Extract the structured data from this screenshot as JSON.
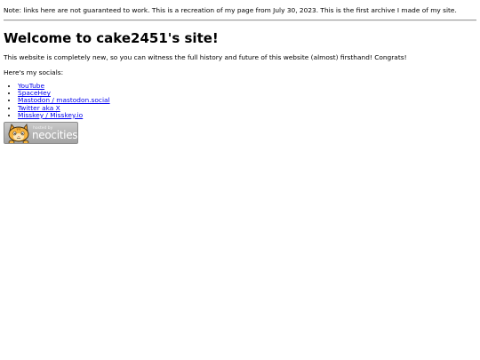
{
  "note": "Note: links here are not guaranteed to work. This is a recreation of my page from July 30, 2023. This is the first archive I made of my site.",
  "heading": "Welcome to cake2451's site!",
  "intro": "This website is completely new, so you can witness the full history and future of this website (almost) firsthand! Congrats!",
  "socials_heading": "Here's my socials:",
  "socials": [
    {
      "label": "YouTube"
    },
    {
      "label": "SpaceHey"
    },
    {
      "label": "Mastodon / mastodon.social"
    },
    {
      "label": "Twitter aka X"
    },
    {
      "label": "Misskey / Misskey.io"
    }
  ],
  "badge": {
    "small_text": "hosted by",
    "brand_text": "neocities",
    "icon": "neocities-cat-logo"
  },
  "colors": {
    "link": "#0000ee",
    "badge_bg": "#b3b3b3",
    "cat_orange": "#f0a030"
  }
}
